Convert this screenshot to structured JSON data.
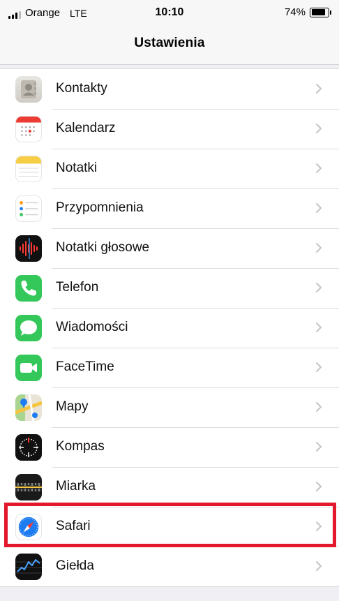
{
  "status": {
    "carrier": "Orange",
    "network": "LTE",
    "time": "10:10",
    "battery_percent": "74%",
    "battery_level": 0.74
  },
  "header": {
    "title": "Ustawienia"
  },
  "settings": {
    "items": [
      {
        "label": "Kontakty",
        "icon": "contacts-icon"
      },
      {
        "label": "Kalendarz",
        "icon": "calendar-icon"
      },
      {
        "label": "Notatki",
        "icon": "notes-icon"
      },
      {
        "label": "Przypomnienia",
        "icon": "reminders-icon"
      },
      {
        "label": "Notatki głosowe",
        "icon": "voice-memos-icon"
      },
      {
        "label": "Telefon",
        "icon": "phone-icon"
      },
      {
        "label": "Wiadomości",
        "icon": "messages-icon"
      },
      {
        "label": "FaceTime",
        "icon": "facetime-icon"
      },
      {
        "label": "Mapy",
        "icon": "maps-icon"
      },
      {
        "label": "Kompas",
        "icon": "compass-icon"
      },
      {
        "label": "Miarka",
        "icon": "measure-icon"
      },
      {
        "label": "Safari",
        "icon": "safari-icon",
        "highlighted": true
      },
      {
        "label": "Giełda",
        "icon": "stocks-icon"
      }
    ]
  },
  "colors": {
    "highlight_border": "#e4182c",
    "phone_green": "#34c759",
    "safari_blue": "#1e7cf2"
  }
}
